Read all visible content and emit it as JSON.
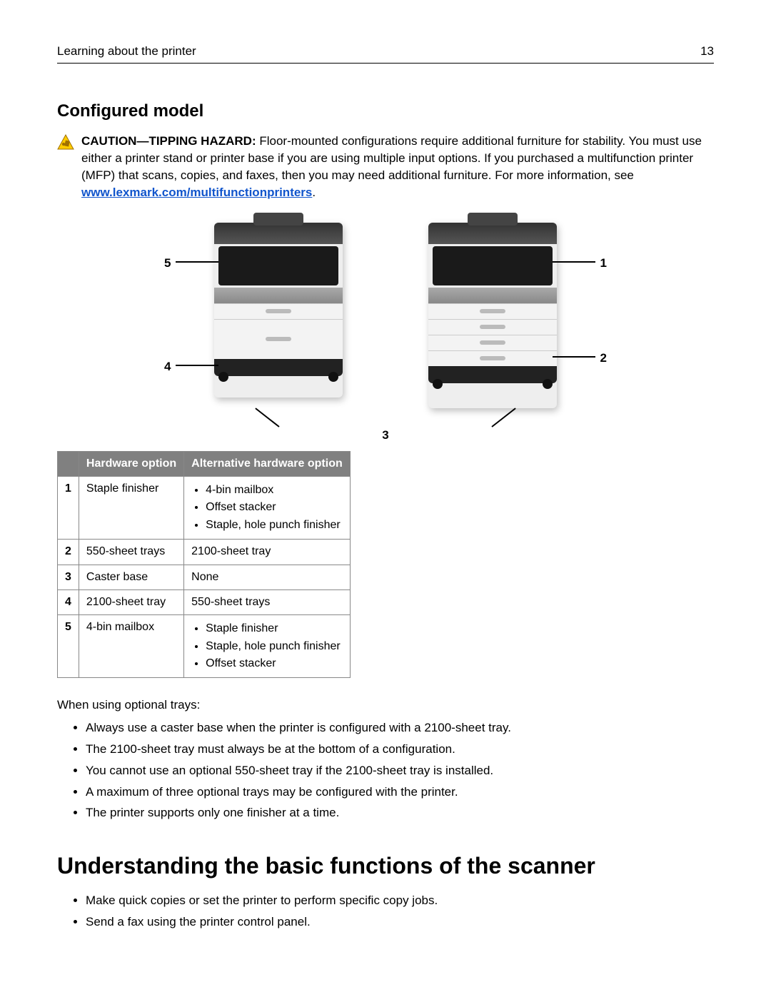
{
  "header": {
    "title": "Learning about the printer",
    "page": "13"
  },
  "section1": {
    "heading": "Configured model",
    "caution_label": "CAUTION—TIPPING HAZARD:",
    "caution_text": " Floor-mounted configurations require additional furniture for stability. You must use either a printer stand or printer base if you are using multiple input options. If you purchased a multifunction printer (MFP) that scans, copies, and faxes, then you may need additional furniture. For more information, see ",
    "caution_link": "www.lexmark.com/multifunctionprinters",
    "caution_after": "."
  },
  "callouts": {
    "c1": "1",
    "c2": "2",
    "c3": "3",
    "c4": "4",
    "c5": "5"
  },
  "table": {
    "h_num": "",
    "h_hw": "Hardware option",
    "h_alt": "Alternative hardware option",
    "rows": [
      {
        "num": "1",
        "hw": "Staple finisher",
        "alt_list": [
          "4‑bin mailbox",
          "Offset stacker",
          "Staple, hole punch finisher"
        ]
      },
      {
        "num": "2",
        "hw": "550‑sheet trays",
        "alt": "2100‑sheet tray"
      },
      {
        "num": "3",
        "hw": "Caster base",
        "alt": "None"
      },
      {
        "num": "4",
        "hw": "2100‑sheet tray",
        "alt": "550‑sheet trays"
      },
      {
        "num": "5",
        "hw": "4‑bin mailbox",
        "alt_list": [
          "Staple finisher",
          "Staple, hole punch finisher",
          "Offset stacker"
        ]
      }
    ]
  },
  "trays_intro": "When using optional trays:",
  "trays_bullets": [
    "Always use a caster base when the printer is configured with a 2100‑sheet tray.",
    "The 2100‑sheet tray must always be at the bottom of a configuration.",
    "You cannot use an optional 550‑sheet tray if the 2100‑sheet tray is installed.",
    "A maximum of three optional trays may be configured with the printer.",
    "The printer supports only one finisher at a time."
  ],
  "section2": {
    "heading": "Understanding the basic functions of the scanner",
    "bullets": [
      "Make quick copies or set the printer to perform specific copy jobs.",
      "Send a fax using the printer control panel."
    ]
  }
}
